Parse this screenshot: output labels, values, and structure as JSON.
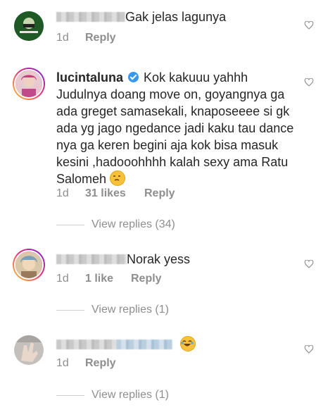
{
  "comments": [
    {
      "username": "",
      "text": "Gak jelas lagunya",
      "time": "1d",
      "likes": "",
      "reply_label": "Reply",
      "avatar_icon": "avatar-green-logo",
      "view_replies": ""
    },
    {
      "username": "lucintaluna",
      "verified": true,
      "text": "Kok kakuuu yahhh Judulnya doang move on, goyangnya ga ada greget samasekali, knaposeeee si gk ada yg jago ngedance jadi kaku tau dance nya ga keren begini aja kok bisa masuk kesini ,hadooohhhh kalah sexy ama Ratu Salomeh",
      "emoji": "unamused-face",
      "time": "1d",
      "likes": "31 likes",
      "reply_label": "Reply",
      "avatar_icon": "avatar-profile-photo",
      "view_replies": "View replies (34)"
    },
    {
      "username": "",
      "text": "Norak yess",
      "time": "1d",
      "likes": "1 like",
      "reply_label": "Reply",
      "avatar_icon": "avatar-profile-photo",
      "view_replies": "View replies (1)"
    },
    {
      "username": "",
      "text": "",
      "emoji": "face-with-tears-of-joy",
      "time": "1d",
      "likes": "",
      "reply_label": "Reply",
      "avatar_icon": "avatar-hand-photo",
      "view_replies": "View replies (1)"
    }
  ],
  "colors": {
    "text": "#262626",
    "meta": "#8e8e8e",
    "verified": "#3897f0"
  },
  "icons": {
    "like": "heart-outline-icon",
    "verified": "verified-badge-icon"
  }
}
